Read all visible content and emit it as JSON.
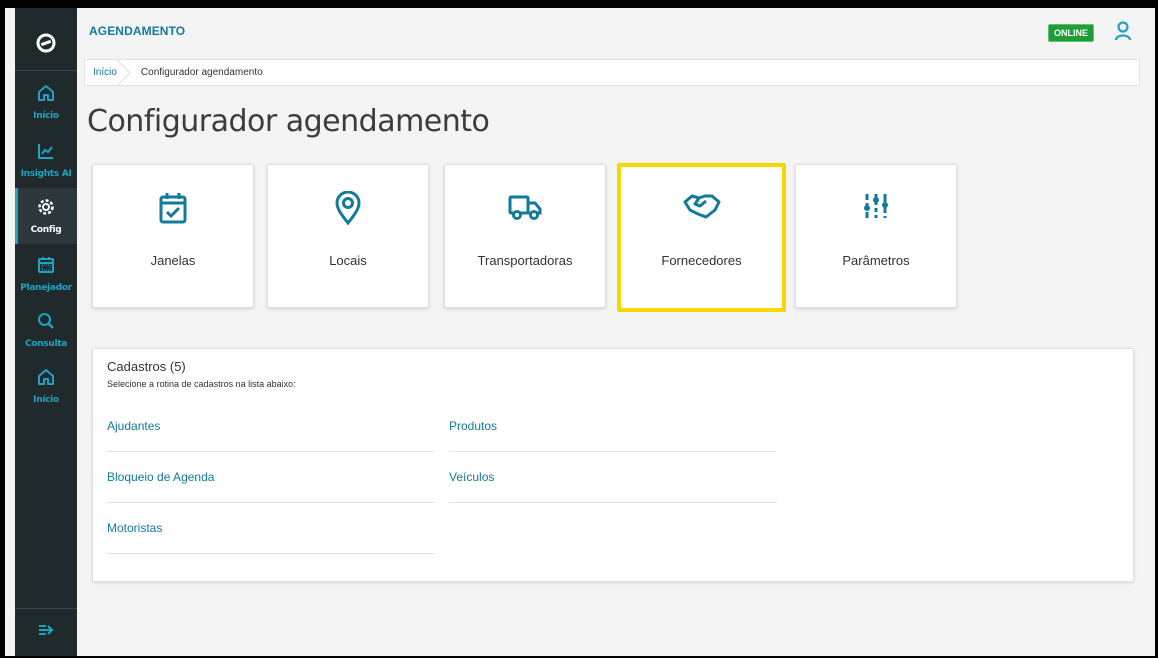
{
  "header": {
    "app_title": "AGENDAMENTO",
    "status_badge": "ONLINE"
  },
  "sidebar": {
    "items": [
      {
        "label": "Início",
        "icon": "home-icon"
      },
      {
        "label": "Insights AI",
        "icon": "chart-icon"
      },
      {
        "label": "Config",
        "icon": "gear-icon",
        "active": true
      },
      {
        "label": "Planejador",
        "icon": "calendar-icon"
      },
      {
        "label": "Consulta",
        "icon": "search-icon"
      },
      {
        "label": "Início",
        "icon": "home-icon"
      }
    ]
  },
  "breadcrumb": {
    "home": "Início",
    "current": "Configurador agendamento"
  },
  "page": {
    "title": "Configurador agendamento"
  },
  "cards": [
    {
      "label": "Janelas",
      "icon": "calendar-check-icon"
    },
    {
      "label": "Locais",
      "icon": "location-pin-icon"
    },
    {
      "label": "Transportadoras",
      "icon": "truck-icon"
    },
    {
      "label": "Fornecedores",
      "icon": "handshake-icon",
      "highlighted": true
    },
    {
      "label": "Parâmetros",
      "icon": "sliders-icon"
    }
  ],
  "cadastros": {
    "title": "Cadastros (5)",
    "subtitle": "Selecione a rotina de cadastros na lista abaixo:",
    "items": [
      "Ajudantes",
      "Produtos",
      "Bloqueio de Agenda",
      "Veículos",
      "Motoristas"
    ]
  },
  "colors": {
    "sidebar_bg": "#202a2d",
    "accent": "#1fa3c2",
    "link": "#127a9a",
    "online": "#1e9e3b",
    "highlight": "#f5d800"
  }
}
